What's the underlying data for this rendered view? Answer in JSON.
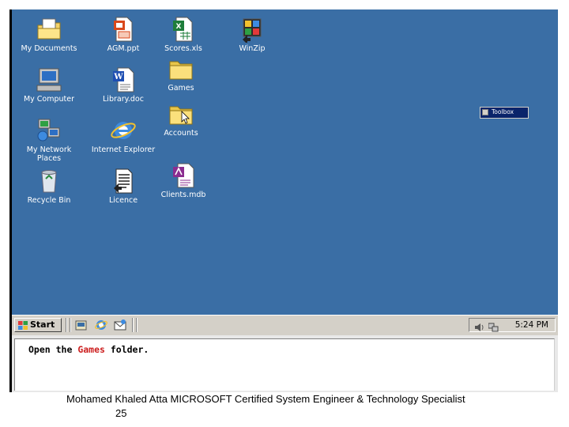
{
  "desktop": {
    "icons": [
      {
        "label": "My Documents",
        "icon": "my-documents-icon"
      },
      {
        "label": "AGM.ppt",
        "icon": "powerpoint-file-icon"
      },
      {
        "label": "Scores.xls",
        "icon": "excel-file-icon"
      },
      {
        "label": "WinZip",
        "icon": "winzip-icon"
      },
      {
        "label": "Games",
        "icon": "folder-icon"
      },
      {
        "label": "My Computer",
        "icon": "my-computer-icon"
      },
      {
        "label": "Library.doc",
        "icon": "word-file-icon"
      },
      {
        "label": "Accounts",
        "icon": "folder-icon"
      },
      {
        "label": "My Network Places",
        "icon": "network-places-icon"
      },
      {
        "label": "Internet Explorer",
        "icon": "internet-explorer-icon"
      },
      {
        "label": "Recycle Bin",
        "icon": "recycle-bin-icon"
      },
      {
        "label": "Licence",
        "icon": "text-document-icon"
      },
      {
        "label": "Clients.mdb",
        "icon": "access-database-icon"
      }
    ],
    "toolbox": {
      "label": "Toolbox"
    },
    "background": "#3a6ea5"
  },
  "taskbar": {
    "start_label": "Start",
    "quick_launch": [
      "show-desktop-icon",
      "internet-explorer-icon",
      "outlook-express-icon"
    ],
    "tray": {
      "time": "5:24 PM",
      "icons": [
        "volume-icon",
        "network-icon"
      ]
    }
  },
  "instruction": {
    "before": "Open the ",
    "highlight": "Games",
    "after": " folder.",
    "highlight_color": "#cc1f1f"
  },
  "footer": {
    "credit": "Mohamed Khaled Atta MICROSOFT Certified System Engineer & Technology Specialist",
    "page_number": "25"
  }
}
